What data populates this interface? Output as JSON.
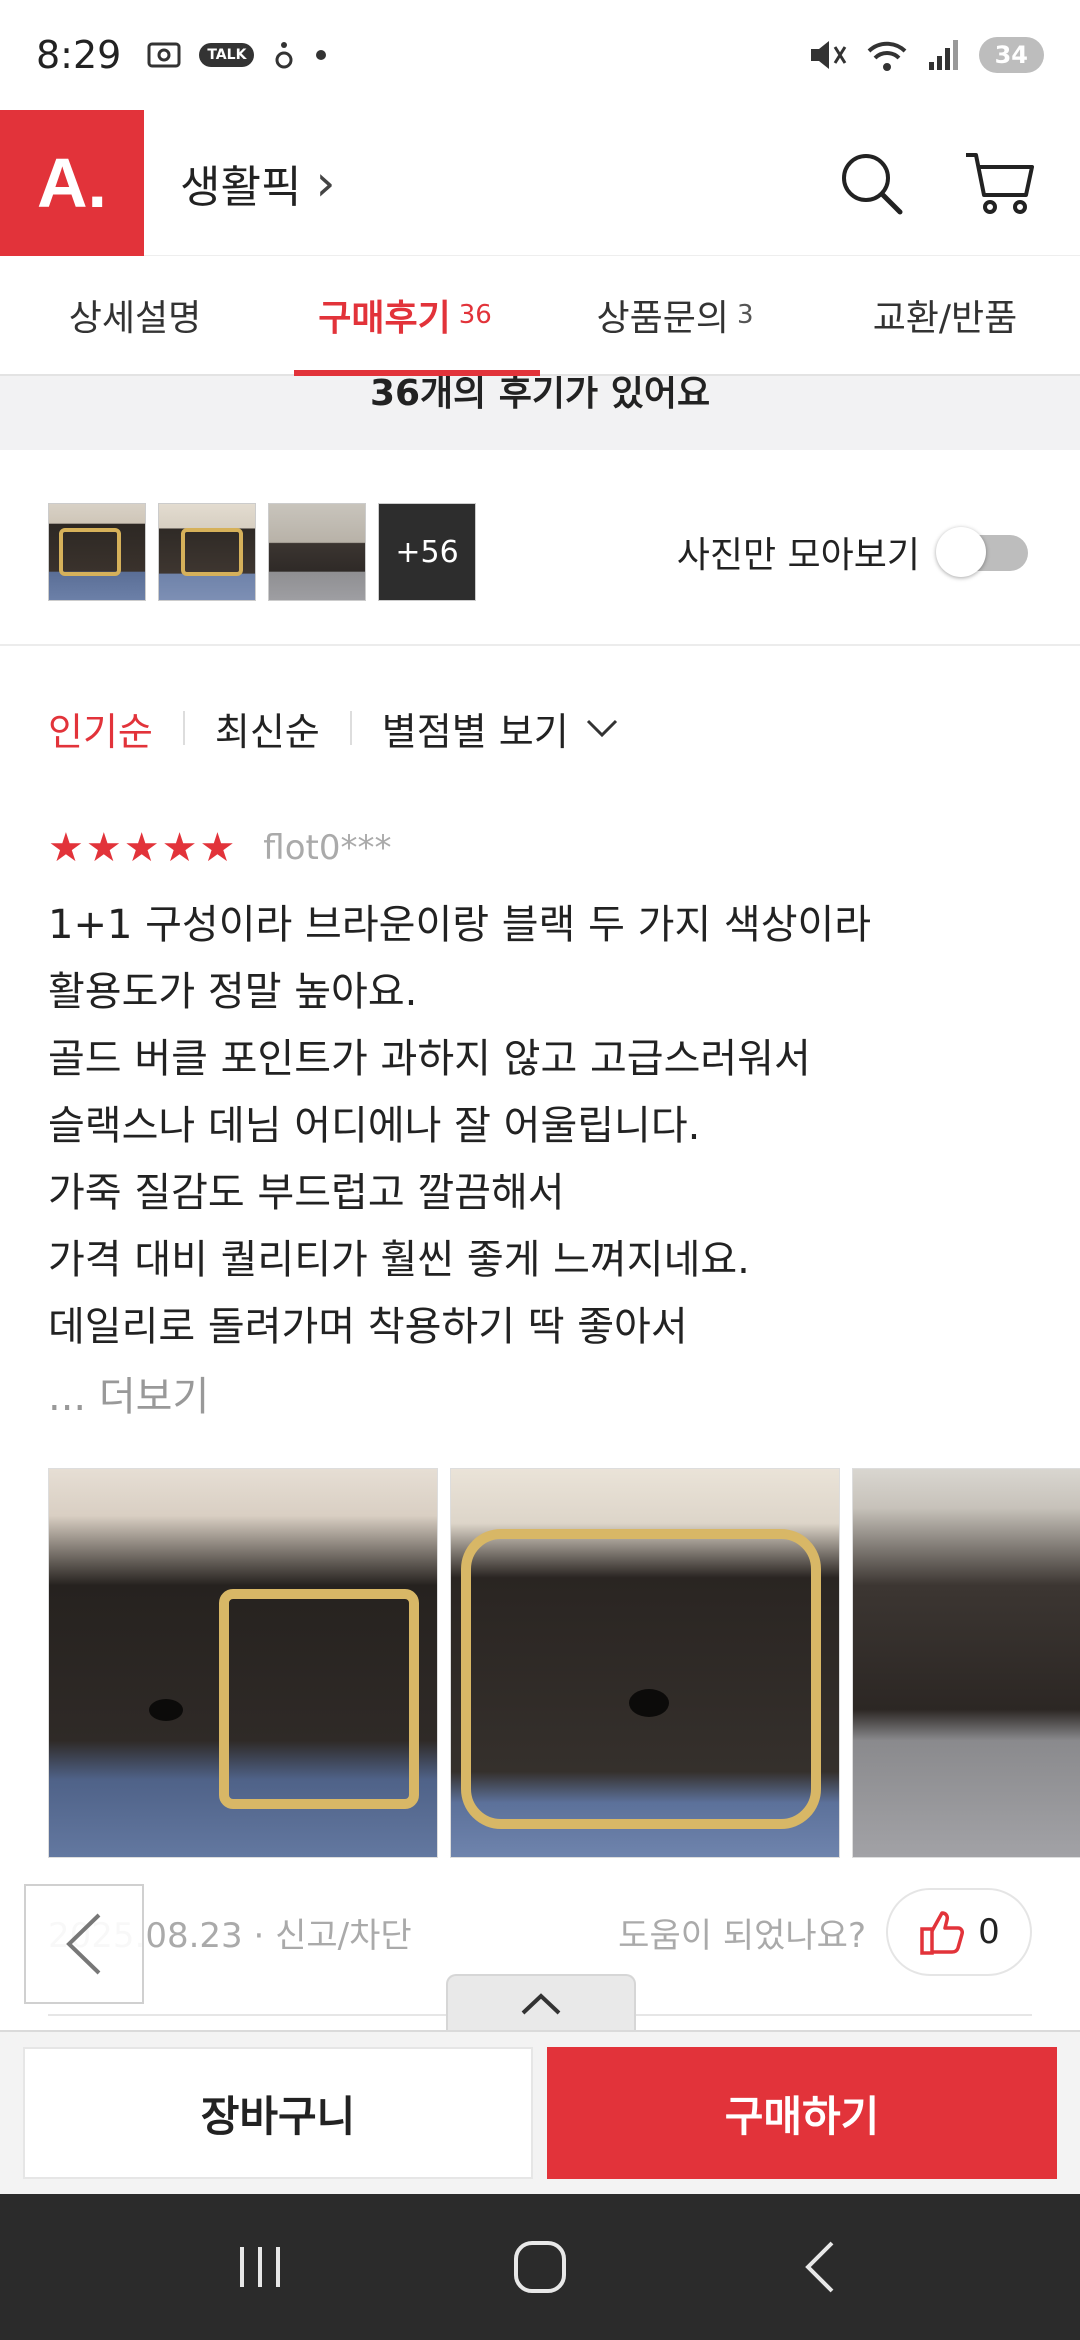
{
  "status_bar": {
    "time": "8:29",
    "talk_badge": "TALK",
    "battery": "34"
  },
  "header": {
    "logo": "A.",
    "title": "생활픽",
    "title_chevron": "›"
  },
  "tabs": [
    {
      "label": "상세설명",
      "count": ""
    },
    {
      "label": "구매후기",
      "count": "36"
    },
    {
      "label": "상품문의",
      "count": "3"
    },
    {
      "label": "교환/반품",
      "count": ""
    }
  ],
  "banner": {
    "text": "36개의 후기가 있어요"
  },
  "photo_strip": {
    "more_label": "+56",
    "photo_only_label": "사진만 모아보기",
    "photo_only_enabled": false
  },
  "sort": {
    "popular": "인기순",
    "latest": "최신순",
    "by_rating": "별점별 보기"
  },
  "review": {
    "rating": 5,
    "reviewer": "flot0***",
    "lines": [
      "1+1 구성이라 브라운이랑 블랙 두 가지 색상이라",
      "활용도가 정말 높아요.",
      "골드 버클 포인트가 과하지 않고 고급스러워서",
      "슬랙스나 데님 어디에나 잘 어울립니다.",
      "가죽 질감도 부드럽고 깔끔해서",
      "가격 대비 퀄리티가 훨씬 좋게 느껴지네요.",
      "데일리로 돌려가며 착용하기 딱 좋아서"
    ],
    "more": "... 더보기",
    "date": "2025.08.23 · 신고/차단",
    "helpful_question": "도움이 되었나요?",
    "like_count": "0"
  },
  "bottom": {
    "cart_label": "장바구니",
    "buy_label": "구매하기"
  },
  "colors": {
    "accent": "#e2333a"
  }
}
